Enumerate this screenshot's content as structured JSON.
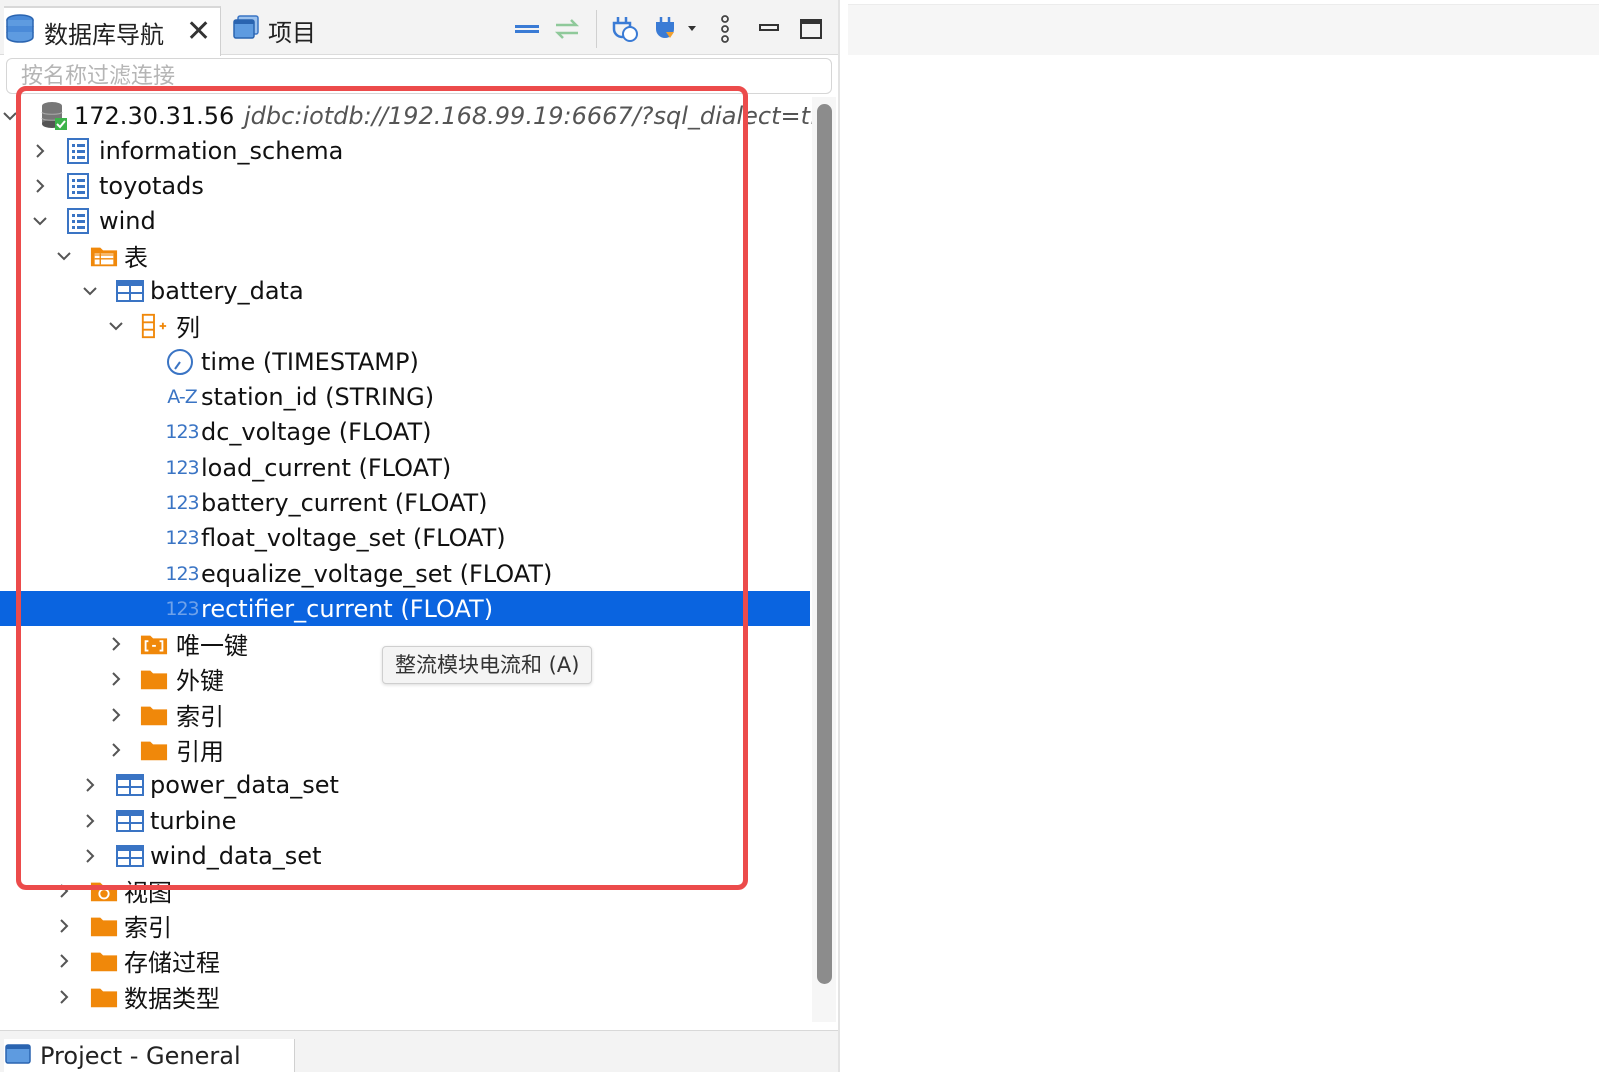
{
  "tabs": {
    "db_navigator": "数据库导航",
    "projects": "项目"
  },
  "filter": {
    "placeholder": "按名称过滤连接"
  },
  "tree": {
    "connection": {
      "name": "172.30.31.56",
      "url": "jdbc:iotdb://192.168.99.19:6667/?sql_dialect=t..."
    },
    "schemas": [
      "information_schema",
      "toyotads",
      "wind"
    ],
    "tables_folder": "表",
    "table_battery": "battery_data",
    "columns_folder": "列",
    "columns": [
      {
        "name": "time (TIMESTAMP)",
        "icon": "clock-icon"
      },
      {
        "name": "station_id (STRING)",
        "icon": "string-type-icon",
        "icon_text": "A-Z"
      },
      {
        "name": "dc_voltage (FLOAT)",
        "icon": "numeric-type-icon",
        "icon_text": "123"
      },
      {
        "name": "load_current (FLOAT)",
        "icon": "numeric-type-icon",
        "icon_text": "123"
      },
      {
        "name": "battery_current (FLOAT)",
        "icon": "numeric-type-icon",
        "icon_text": "123"
      },
      {
        "name": "float_voltage_set (FLOAT)",
        "icon": "numeric-type-icon",
        "icon_text": "123"
      },
      {
        "name": "equalize_voltage_set (FLOAT)",
        "icon": "numeric-type-icon",
        "icon_text": "123"
      },
      {
        "name": "rectifier_current (FLOAT)",
        "icon": "numeric-type-icon",
        "icon_text": "123",
        "selected": true
      }
    ],
    "battery_subfolders": [
      "唯一键",
      "外键",
      "索引",
      "引用"
    ],
    "other_tables": [
      "power_data_set",
      "turbine",
      "wind_data_set"
    ],
    "wind_folders": [
      "视图",
      "索引",
      "存储过程",
      "数据类型"
    ]
  },
  "tooltip": "整流模块电流和 (A)",
  "bottom_tab": {
    "label": "Project - General"
  },
  "colors": {
    "selection": "#0a64e0",
    "highlight_box": "#ec4b4b",
    "folder": "#f0880a",
    "icon_blue": "#3a74c4"
  }
}
